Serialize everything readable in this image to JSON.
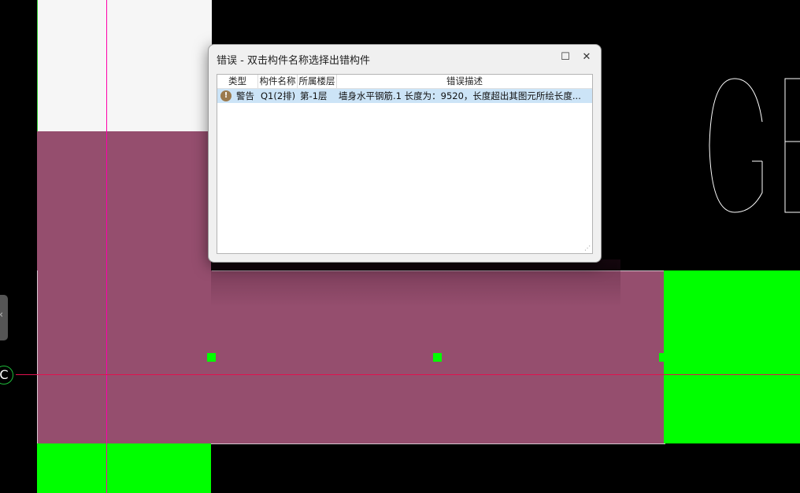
{
  "canvas": {
    "axis_label": "C",
    "side_tab_icon": "chevron-left-icon"
  },
  "dialog": {
    "title": "错误 - 双击构件名称选择出错构件",
    "maximize_icon": "maximize-icon",
    "close_icon": "close-icon",
    "columns": [
      "类型",
      "构件名称",
      "所属楼层",
      "错误描述"
    ],
    "rows": [
      {
        "type": "警告",
        "icon": "warning-icon",
        "name": "Q1(2排)",
        "floor": "第-1层",
        "description": "墙身水平钢筋.1 长度为：9520，长度超出其图元所绘长度..."
      }
    ]
  },
  "colors": {
    "wall": "#954e6e",
    "grip": "#00ff00",
    "selection": "#cce4f7"
  }
}
